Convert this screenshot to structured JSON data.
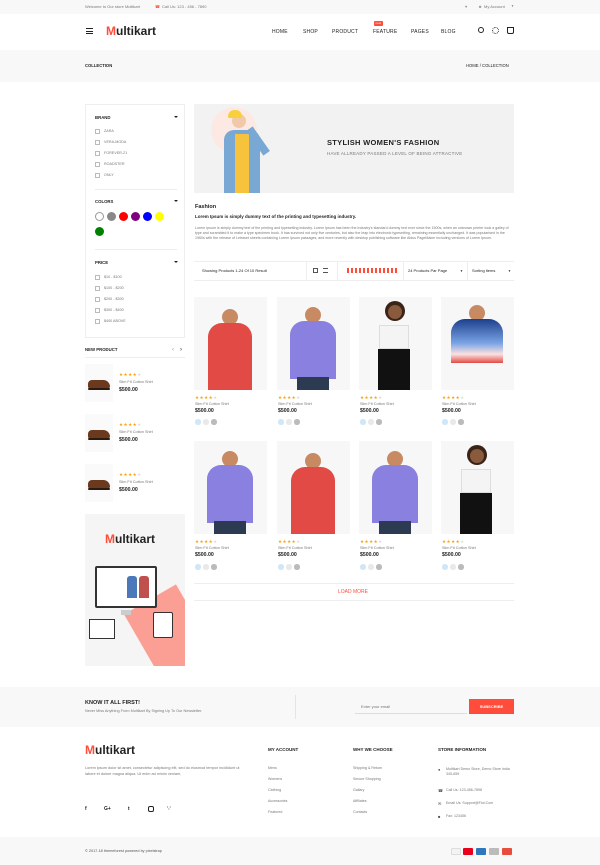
{
  "topbar": {
    "welcome": "Welcome to Our store Multikart",
    "call": "Call Us: 123 - 456 - 7890",
    "account": "My Account",
    "colors": {
      "accent": "#ff4c3b"
    }
  },
  "header": {
    "logo_letter": "M",
    "logo_rest": "ultikart",
    "nav": [
      "HOME",
      "SHOP",
      "PRODUCT",
      "FEATURE",
      "PAGES",
      "BLOG"
    ],
    "new_badge": "new",
    "icons": [
      "menu-icon",
      "search-icon",
      "settings-icon",
      "cart-icon"
    ]
  },
  "breadcrumb": {
    "page_title": "COLLECTION",
    "path": "HOME  /  COLLECTION"
  },
  "filters": {
    "brand": {
      "title": "BRAND",
      "items": [
        "ZARA",
        "VERA-MODA",
        "FOREVER-21",
        "ROADSTER",
        "ONLY"
      ]
    },
    "colors": {
      "title": "COLORS",
      "swatches": [
        "#ffffff",
        "#888888",
        "#ff0000",
        "#800080",
        "#0000ff",
        "#ffff00",
        "#008000"
      ]
    },
    "price": {
      "title": "PRICE",
      "items": [
        "$10 - $100",
        "$100 - $200",
        "$200 - $300",
        "$300 - $400",
        "$400 ABOVE"
      ]
    }
  },
  "new_product": {
    "title": "NEW PRODUCT",
    "items": [
      {
        "name": "Slim Fit Cotton Shirt",
        "price": "$500.00"
      },
      {
        "name": "Slim Fit Cotton Shirt",
        "price": "$500.00"
      },
      {
        "name": "Slim Fit Cotton Shirt",
        "price": "$500.00"
      }
    ]
  },
  "side_banner": {
    "logo_letter": "M",
    "logo_rest": "ultikart"
  },
  "hero": {
    "title": "STYLISH WOMEN'S FASHION",
    "subtitle": "HAVE ALLREADY PASSED A LEVEL OF BEING ATTRACTIVE"
  },
  "intro": {
    "heading": "Fashion",
    "lead": "Lorem Ipsum is simply dummy text of the printing and typesetting industry.",
    "body": "Lorem Ipsum is simply dummy text of the printing and typesetting industry. Lorem Ipsum has been the industry's standard dummy text ever since the 1500s, when an unknown printer took a galley of type and scrambled it to make a type specimen book. It has survived not only five centuries, but also the leap into electronic typesetting, remaining essentially unchanged. It was popularised in the 1960s with the release of Letraset sheets containing Lorem Ipsum passages, and more recently with desktop publishing software like Aldus PageMaker including versions of Lorem Ipsum."
  },
  "toolbar": {
    "showing": "Showing Products 1-24 Of 10 Result",
    "per_page": "24 Products Par Page",
    "sort": "Sorting items"
  },
  "products": [
    {
      "name": "Slim Fit Cotton Shirt",
      "price": "$500.00"
    },
    {
      "name": "Slim Fit Cotton Shirt",
      "price": "$500.00"
    },
    {
      "name": "Slim Fit Cotton Shirt",
      "price": "$500.00"
    },
    {
      "name": "Slim Fit Cotton Shirt",
      "price": "$500.00"
    },
    {
      "name": "Slim Fit Cotton Shirt",
      "price": "$500.00"
    },
    {
      "name": "Slim Fit Cotton Shirt",
      "price": "$500.00"
    },
    {
      "name": "Slim Fit Cotton Shirt",
      "price": "$500.00"
    },
    {
      "name": "Slim Fit Cotton Shirt",
      "price": "$500.00"
    }
  ],
  "load_more": "LOAD MORE",
  "newsletter": {
    "title": "KNOW IT ALL FIRST!",
    "subtitle": "Never Miss Anything From Multikart By Signing Up To Our Newsletter.",
    "placeholder": "Enter your email",
    "button": "SUBSCRIBE"
  },
  "footer": {
    "logo_letter": "M",
    "logo_rest": "ultikart",
    "about": "Lorem ipsum dolor sit amet, consectetur adipiscing elit, sed do eiusmod tempor incididunt ut labore et dolore magna aliqua. Ut enim ad minim veniam,",
    "social": [
      "f",
      "G+",
      "t",
      "ig",
      "rss"
    ],
    "my_account": {
      "title": "MY ACCOUNT",
      "items": [
        "Mens",
        "Womens",
        "Clothing",
        "Accessories",
        "Featured"
      ]
    },
    "why": {
      "title": "WHY WE CHOOSE",
      "items": [
        "Shipping & Return",
        "Secure Shopping",
        "Gallary",
        "Affiliates",
        "Contacts"
      ]
    },
    "store": {
      "title": "STORE INFORMATION",
      "address": "Multikart Demo Store, Demo Store India 345-659",
      "call": "Call Us: 123-456-7898",
      "email": "Email Us: Support@Fiot.Com",
      "fax": "Fax: 123456"
    },
    "copyright": "© 2017-18 themeforest powered by pixelstrap"
  }
}
